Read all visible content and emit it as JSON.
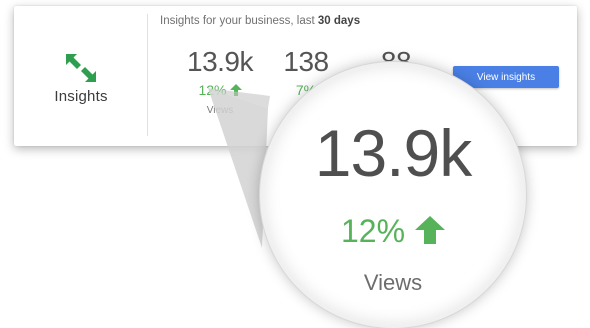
{
  "insights": {
    "title": "Insights",
    "icon": "swap-arrows-icon",
    "headline_prefix": "Insights for your business, last ",
    "headline_emphasis": "30 days",
    "metrics": [
      {
        "value": "13.9k",
        "change": "12%",
        "label": "Views"
      },
      {
        "value": "138",
        "change": "7%",
        "label": ""
      },
      {
        "value": "88",
        "change": "",
        "label": ""
      }
    ],
    "button_label": "View insights"
  },
  "magnifier": {
    "value": "13.9k",
    "change": "12%",
    "label": "Views"
  },
  "colors": {
    "accent_green": "#57b35a",
    "button_blue": "#4a80e6",
    "icon_green": "#2e9e4f"
  }
}
